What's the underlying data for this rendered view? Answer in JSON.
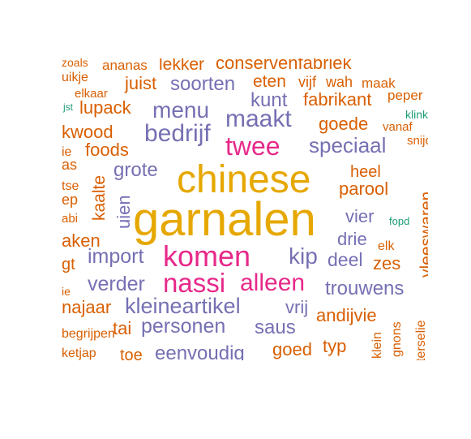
{
  "colors": {
    "gold": "#E6A800",
    "pink": "#E7298A",
    "purple": "#7570B3",
    "orange": "#D95F02",
    "teal": "#1B9E77"
  },
  "words": [
    {
      "text": "garnalen",
      "color": "gold"
    },
    {
      "text": "chinese",
      "color": "gold"
    },
    {
      "text": "komen",
      "color": "pink"
    },
    {
      "text": "twee",
      "color": "pink"
    },
    {
      "text": "nassi",
      "color": "pink"
    },
    {
      "text": "alleen",
      "color": "pink"
    },
    {
      "text": "bedrijf",
      "color": "purple"
    },
    {
      "text": "maakt",
      "color": "purple"
    },
    {
      "text": "menu",
      "color": "purple"
    },
    {
      "text": "speciaal",
      "color": "purple"
    },
    {
      "text": "kleineartikel",
      "color": "purple"
    },
    {
      "text": "personen",
      "color": "purple"
    },
    {
      "text": "import",
      "color": "purple"
    },
    {
      "text": "kip",
      "color": "purple"
    },
    {
      "text": "verder",
      "color": "purple"
    },
    {
      "text": "trouwens",
      "color": "purple"
    },
    {
      "text": "eenvoudig",
      "color": "purple"
    },
    {
      "text": "soorten",
      "color": "purple"
    },
    {
      "text": "kunt",
      "color": "purple"
    },
    {
      "text": "grote",
      "color": "purple"
    },
    {
      "text": "uien",
      "color": "purple"
    },
    {
      "text": "saus",
      "color": "purple"
    },
    {
      "text": "deel",
      "color": "purple"
    },
    {
      "text": "vier",
      "color": "purple"
    },
    {
      "text": "drie",
      "color": "purple"
    },
    {
      "text": "vrij",
      "color": "purple"
    },
    {
      "text": "vleeswaren",
      "color": "orange"
    },
    {
      "text": "fabrikant",
      "color": "orange"
    },
    {
      "text": "conservenfabriek",
      "color": "orange"
    },
    {
      "text": "lekker",
      "color": "orange"
    },
    {
      "text": "ananas",
      "color": "orange"
    },
    {
      "text": "zoals",
      "color": "orange"
    },
    {
      "text": "juist",
      "color": "orange"
    },
    {
      "text": "eten",
      "color": "orange"
    },
    {
      "text": "vijf",
      "color": "orange"
    },
    {
      "text": "wah",
      "color": "orange"
    },
    {
      "text": "maak",
      "color": "orange"
    },
    {
      "text": "peper",
      "color": "orange"
    },
    {
      "text": "lupack",
      "color": "orange"
    },
    {
      "text": "kwood",
      "color": "orange"
    },
    {
      "text": "foods",
      "color": "orange"
    },
    {
      "text": "goede",
      "color": "orange"
    },
    {
      "text": "vanaf",
      "color": "orange"
    },
    {
      "text": "snijd",
      "color": "orange"
    },
    {
      "text": "heel",
      "color": "orange"
    },
    {
      "text": "parool",
      "color": "orange"
    },
    {
      "text": "kaalte",
      "color": "orange"
    },
    {
      "text": "zes",
      "color": "orange"
    },
    {
      "text": "elk",
      "color": "orange"
    },
    {
      "text": "najaar",
      "color": "orange"
    },
    {
      "text": "andijvie",
      "color": "orange"
    },
    {
      "text": "tai",
      "color": "orange"
    },
    {
      "text": "typ",
      "color": "orange"
    },
    {
      "text": "goed",
      "color": "orange"
    },
    {
      "text": "toe",
      "color": "orange"
    },
    {
      "text": "begrijpen",
      "color": "orange"
    },
    {
      "text": "ketjap",
      "color": "orange"
    },
    {
      "text": "klein",
      "color": "orange"
    },
    {
      "text": "gnons",
      "color": "orange"
    },
    {
      "text": "terselie",
      "color": "orange"
    },
    {
      "text": "elkaar",
      "color": "orange"
    },
    {
      "text": "uikje",
      "color": "orange"
    },
    {
      "text": "ie",
      "color": "orange"
    },
    {
      "text": "as",
      "color": "orange"
    },
    {
      "text": "tse",
      "color": "orange"
    },
    {
      "text": "ep",
      "color": "orange"
    },
    {
      "text": "abi",
      "color": "orange"
    },
    {
      "text": "aken",
      "color": "orange"
    },
    {
      "text": "gt",
      "color": "orange"
    },
    {
      "text": "ie",
      "color": "orange"
    },
    {
      "text": "jst",
      "color": "teal"
    },
    {
      "text": "klinkt",
      "color": "teal"
    },
    {
      "text": "fopd",
      "color": "teal"
    }
  ]
}
